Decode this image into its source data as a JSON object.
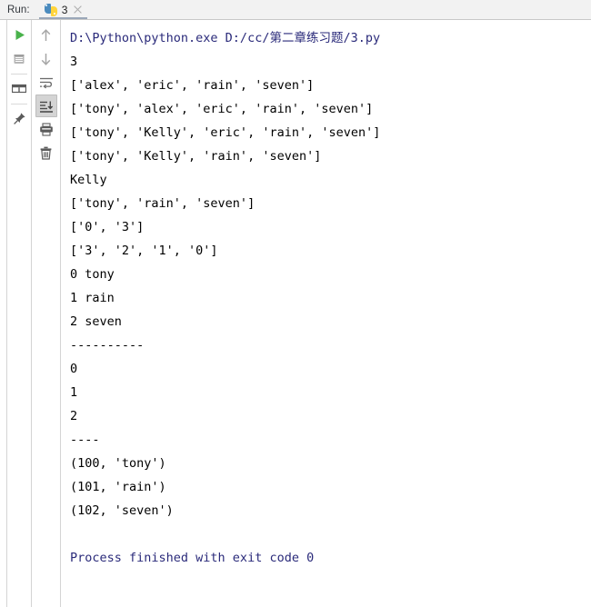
{
  "window": {
    "title": "Run"
  },
  "runbar": {
    "label": "Run:",
    "tab": {
      "icon": "python-file-icon",
      "label": "3",
      "close_icon": "close-icon"
    }
  },
  "toolbar_left": {
    "items": [
      {
        "name": "rerun-button",
        "icon": "play-icon",
        "tooltip": "Rerun"
      },
      {
        "name": "stop-button",
        "icon": "stop-icon",
        "tooltip": "Stop"
      },
      {
        "name": "layout-button",
        "icon": "columns-icon",
        "tooltip": "Layout"
      },
      {
        "name": "pin-tab-button",
        "icon": "pin-icon",
        "tooltip": "Pin Tab"
      }
    ]
  },
  "toolbar_right": {
    "items": [
      {
        "name": "up-the-stack-trace-button",
        "icon": "arrow-up-icon",
        "tooltip": "Up the Stack Trace",
        "pressed": false
      },
      {
        "name": "down-the-stack-trace-button",
        "icon": "arrow-down-icon",
        "tooltip": "Down the Stack Trace",
        "pressed": false
      },
      {
        "name": "soft-wrap-button",
        "icon": "soft-wrap-icon",
        "tooltip": "Use Soft Wraps",
        "pressed": false
      },
      {
        "name": "scroll-to-end-button",
        "icon": "scroll-to-end-icon",
        "tooltip": "Scroll to the end",
        "pressed": true
      },
      {
        "name": "print-button",
        "icon": "printer-icon",
        "tooltip": "Print",
        "pressed": false
      },
      {
        "name": "clear-all-button",
        "icon": "trash-icon",
        "tooltip": "Clear All",
        "pressed": false
      }
    ]
  },
  "console": {
    "lines": [
      {
        "text": "D:\\Python\\python.exe D:/cc/第二章练习题/3.py",
        "style": "cmd"
      },
      {
        "text": "3",
        "style": "out"
      },
      {
        "text": "['alex', 'eric', 'rain', 'seven']",
        "style": "out"
      },
      {
        "text": "['tony', 'alex', 'eric', 'rain', 'seven']",
        "style": "out"
      },
      {
        "text": "['tony', 'Kelly', 'eric', 'rain', 'seven']",
        "style": "out"
      },
      {
        "text": "['tony', 'Kelly', 'rain', 'seven']",
        "style": "out"
      },
      {
        "text": "Kelly",
        "style": "out"
      },
      {
        "text": "['tony', 'rain', 'seven']",
        "style": "out"
      },
      {
        "text": "['0', '3']",
        "style": "out"
      },
      {
        "text": "['3', '2', '1', '0']",
        "style": "out"
      },
      {
        "text": "0 tony",
        "style": "out"
      },
      {
        "text": "1 rain",
        "style": "out"
      },
      {
        "text": "2 seven",
        "style": "out"
      },
      {
        "text": "----------",
        "style": "out"
      },
      {
        "text": "0",
        "style": "out"
      },
      {
        "text": "1",
        "style": "out"
      },
      {
        "text": "2",
        "style": "out"
      },
      {
        "text": "----",
        "style": "out"
      },
      {
        "text": "(100, 'tony')",
        "style": "out"
      },
      {
        "text": "(101, 'rain')",
        "style": "out"
      },
      {
        "text": "(102, 'seven')",
        "style": "out"
      },
      {
        "text": "",
        "style": "blank"
      },
      {
        "text": "Process finished with exit code 0",
        "style": "fin"
      }
    ]
  },
  "colors": {
    "console_background": "#ffffff",
    "output_text": "#000000",
    "command_text": "#2a2a7a",
    "exit_text": "#2a2a7a",
    "toolbar_background": "#ffffff",
    "runbar_background": "#f2f2f2",
    "pressed_button": "#d4d4d4",
    "tab_underline": "#9aa7b8"
  }
}
